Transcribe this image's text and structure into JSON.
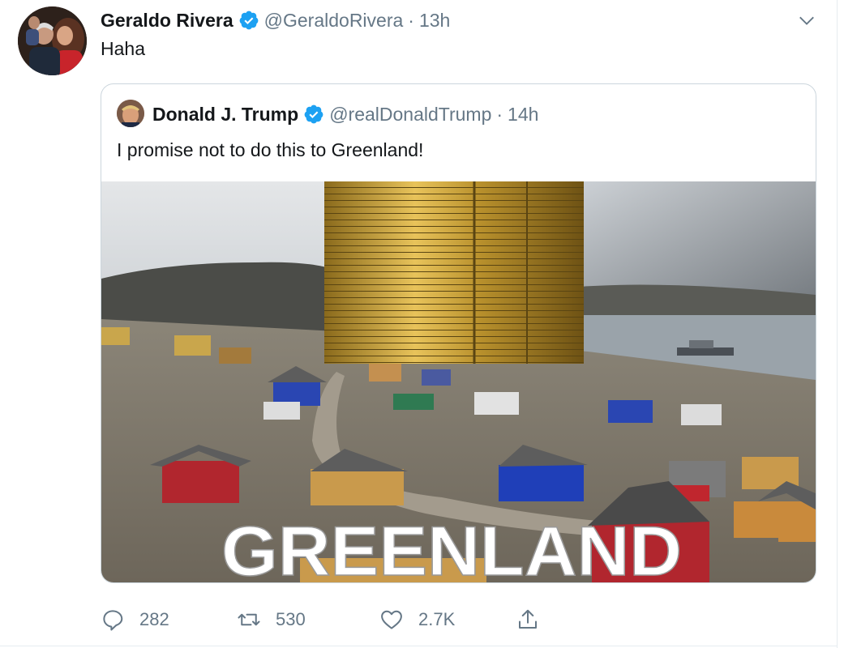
{
  "tweet": {
    "author_name": "Geraldo Rivera",
    "author_handle": "@GeraldoRivera",
    "separator": "·",
    "time": "13h",
    "text": "Haha",
    "avatar_icon": "profile-photo",
    "menu_icon": "chevron-down-icon"
  },
  "quoted_tweet": {
    "author_name": "Donald J. Trump",
    "author_handle": "@realDonaldTrump",
    "separator": "·",
    "time": "14h",
    "text": "I promise not to do this to Greenland!",
    "media": {
      "overlay_text": "GREENLAND",
      "description_icon": "photo"
    }
  },
  "actions": {
    "reply_count": "282",
    "retweet_count": "530",
    "like_count": "2.7K"
  },
  "colors": {
    "text_primary": "#14171a",
    "text_secondary": "#657786",
    "verified_blue": "#1da1f2",
    "border": "#ccd6dd"
  }
}
